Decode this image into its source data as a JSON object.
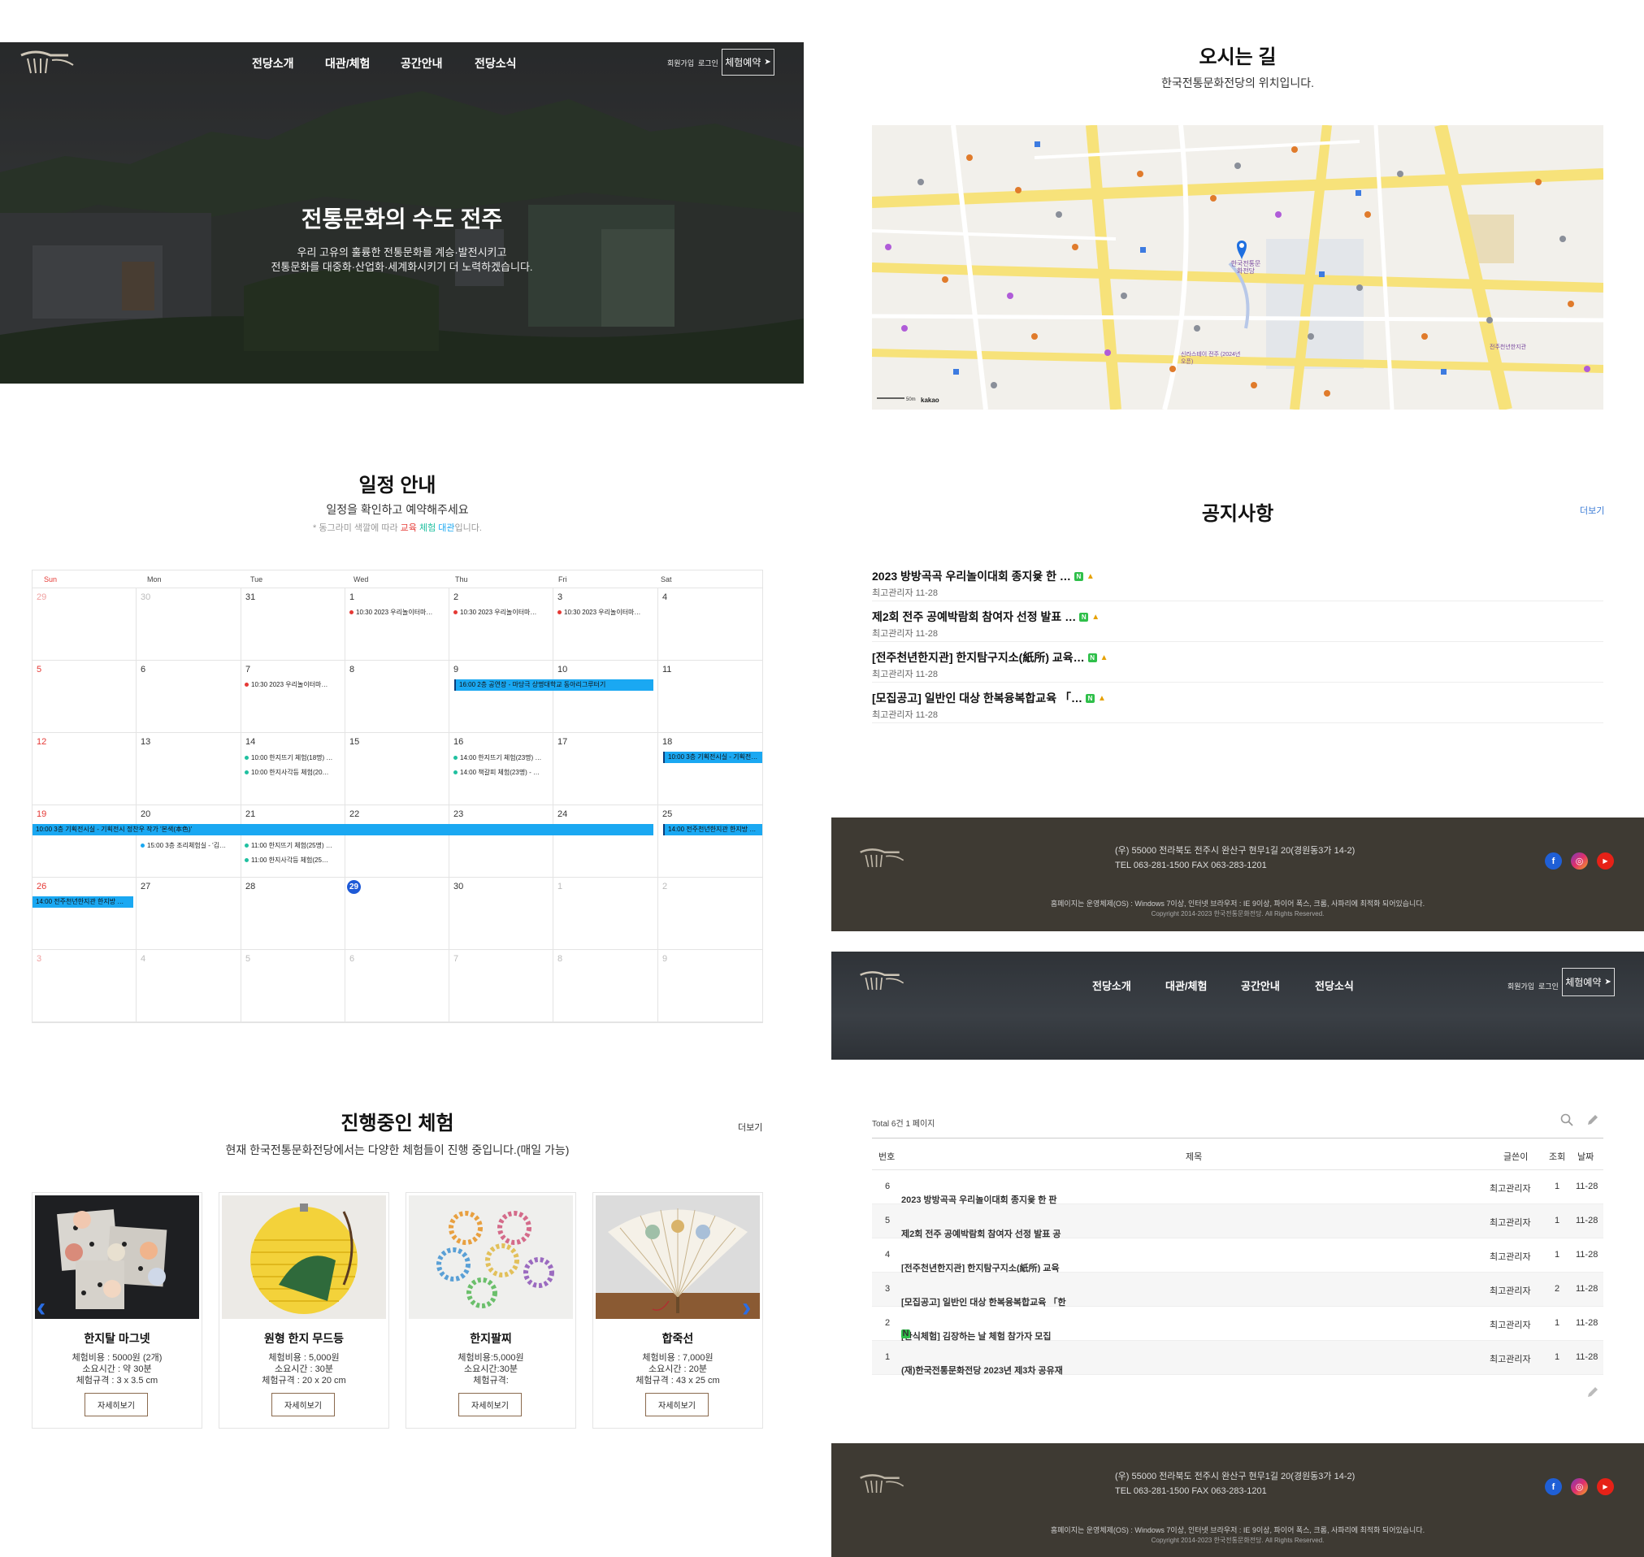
{
  "header": {
    "nav": [
      "전당소개",
      "대관/체험",
      "공간안내",
      "전당소식"
    ],
    "signup": "회원가입",
    "login": "로그인",
    "reserve": "체험예약"
  },
  "hero": {
    "title": "전통문화의 수도 전주",
    "line1": "우리 고유의 훌륭한 전통문화를 계승·발전시키고",
    "line2": "전통문화를 대중화·산업화·세계화시키기 더 노력하겠습니다."
  },
  "directions": {
    "title": "오시는 길",
    "subtitle": "한국전통문화전당의 위치입니다.",
    "map_labels": [
      "한국전통문화전당",
      "신라스테이 전주 (2024년 오픈)",
      "전주천년한지관",
      "kakao",
      "50m"
    ]
  },
  "schedule": {
    "title": "일정 안내",
    "subtitle": "일정을 확인하고 예약해주세요",
    "legend_prefix": "* 동그라미 색깔에 따라 ",
    "legend_edu": "교육",
    "legend_exp": "체험",
    "legend_rent": "대관",
    "legend_suffix": "입니다.",
    "colors": {
      "edu": "#e53935",
      "exp": "#20c0a0",
      "rent": "#1aa8f2"
    },
    "weekdays": [
      "Sun",
      "Mon",
      "Tue",
      "Wed",
      "Thu",
      "Fri",
      "Sat"
    ],
    "weeks": [
      [
        "29",
        "30",
        "31",
        "1",
        "2",
        "3",
        "4"
      ],
      [
        "5",
        "6",
        "7",
        "8",
        "9",
        "10",
        "11"
      ],
      [
        "12",
        "13",
        "14",
        "15",
        "16",
        "17",
        "18"
      ],
      [
        "19",
        "20",
        "21",
        "22",
        "23",
        "24",
        "25"
      ],
      [
        "26",
        "27",
        "28",
        "29",
        "30",
        "1",
        "2"
      ],
      [
        "3",
        "4",
        "5",
        "6",
        "7",
        "8",
        "9"
      ]
    ],
    "events": {
      "e_w0_wed": "10:30 2023 우리놀이터마…",
      "e_w0_thu": "10:30 2023 우리놀이터마…",
      "e_w0_fri": "10:30 2023 우리놀이터마…",
      "e_w1_tue": "10:30 2023 우리놀이터마…",
      "bar_w1": "16:00 2층 공연장 - 마당극 상명대학교 동아리그루터기",
      "e_w2_tue1": "10:00 한지뜨기 체험(18명) …",
      "e_w2_tue2": "10:00 한지사각등 체험(20…",
      "e_w2_thu1": "14:00 한지뜨기 체험(23명) …",
      "e_w2_thu2": "14:00 책갈피 체험(23명) - …",
      "bar_w2_sat": "10:00 3층 기획전시실 - 기획전…",
      "bar_w3": "10:00 3층 기획전시실 - 기획전시 정찬우 작가 '본색(本色)'",
      "bar_w3_sat": "14:00 전주천년한지관 한지방 …",
      "e_w3_mon": "15:00 3층 조리체험실 - '김…",
      "e_w3_tue1": "11:00 한지뜨기 체험(25명) …",
      "e_w3_tue2": "11:00 한지사각등 체험(25…",
      "bar_w4_sun": "14:00 전주천년한지관 한지방 …"
    }
  },
  "notice": {
    "title": "공지사항",
    "more": "더보기",
    "items": [
      {
        "title": "2023 방방곡곡 우리놀이대회 종지윷 한 …",
        "meta": "최고관리자 11-28"
      },
      {
        "title": "제2회 전주 공예박람회 참여자 선정 발표 …",
        "meta": "최고관리자 11-28"
      },
      {
        "title": "[전주천년한지관] 한지탐구지소(紙所) 교육…",
        "meta": "최고관리자 11-28"
      },
      {
        "title": "[모집공고] 일반인 대상 한복융복합교육 「…",
        "meta": "최고관리자 11-28"
      }
    ]
  },
  "footer": {
    "address": "(우) 55000 전라북도 전주시 완산구 현무1길 20(경원동3가 14-2)",
    "tel": "TEL 063-281-1500 FAX 063-283-1201",
    "info": "홈페이지는 운영체제(OS) : Windows 7이상, 인터넷 브라우저 : IE 9이상, 파이어 폭스, 크롬, 사파리에 최적화 되어있습니다.",
    "copyright": "Copyright 2014-2023 한국전통문화전당. All Rights Reserved.",
    "sns": [
      "f",
      "◎",
      "▶"
    ]
  },
  "board": {
    "total": "Total 6건 1 페이지",
    "headers": [
      "번호",
      "제목",
      "글쓴이",
      "조회",
      "날짜"
    ],
    "rows": [
      {
        "no": "6",
        "title": "2023 방방곡곡 우리놀이대회 종지윷 한 판",
        "author": "최고관리자",
        "views": "1",
        "date": "11-28"
      },
      {
        "no": "5",
        "title": "제2회 전주 공예박람회 참여자 선정 발표 공",
        "author": "최고관리자",
        "views": "1",
        "date": "11-28"
      },
      {
        "no": "4",
        "title": "[전주천년한지관] 한지탐구지소(紙所) 교육",
        "author": "최고관리자",
        "views": "1",
        "date": "11-28"
      },
      {
        "no": "3",
        "title": "[모집공고] 일반인 대상 한복융복합교육 「한",
        "author": "최고관리자",
        "views": "2",
        "date": "11-28"
      },
      {
        "no": "2",
        "title": "[한식체험] 김장하는 날 체험 참가자 모집",
        "author": "최고관리자",
        "views": "1",
        "date": "11-28"
      },
      {
        "no": "1",
        "title": "(재)한국전통문화전당 2023년 제3차 공유재",
        "author": "최고관리자",
        "views": "1",
        "date": "11-28"
      }
    ]
  },
  "experience": {
    "title": "진행중인 체험",
    "subtitle": "현재 한국전통문화전당에서는 다양한 체험들이 진행 중입니다.(매일 가능)",
    "more": "더보기",
    "cards": [
      {
        "name": "한지탈 마그넷",
        "l1": "체험비용 : 5000원 (2개)",
        "l2": "소요시간 : 약 30분",
        "l3": "체험규격 : 3 x 3.5 cm",
        "btn": "자세히보기"
      },
      {
        "name": "원형 한지 무드등",
        "l1": "체험비용 : 5,000원",
        "l2": "소요시간 : 30분",
        "l3": "체험규격 : 20 x 20 cm",
        "btn": "자세히보기"
      },
      {
        "name": "한지팔찌",
        "l1": "체험비용:5,000원",
        "l2": "소요시간:30분",
        "l3": "체험규격:",
        "btn": "자세히보기"
      },
      {
        "name": "합죽선",
        "l1": "체험비용 : 7,000원",
        "l2": "소요시간 : 20분",
        "l3": "체험규격 : 43 x 25 cm",
        "btn": "자세히보기"
      }
    ]
  }
}
